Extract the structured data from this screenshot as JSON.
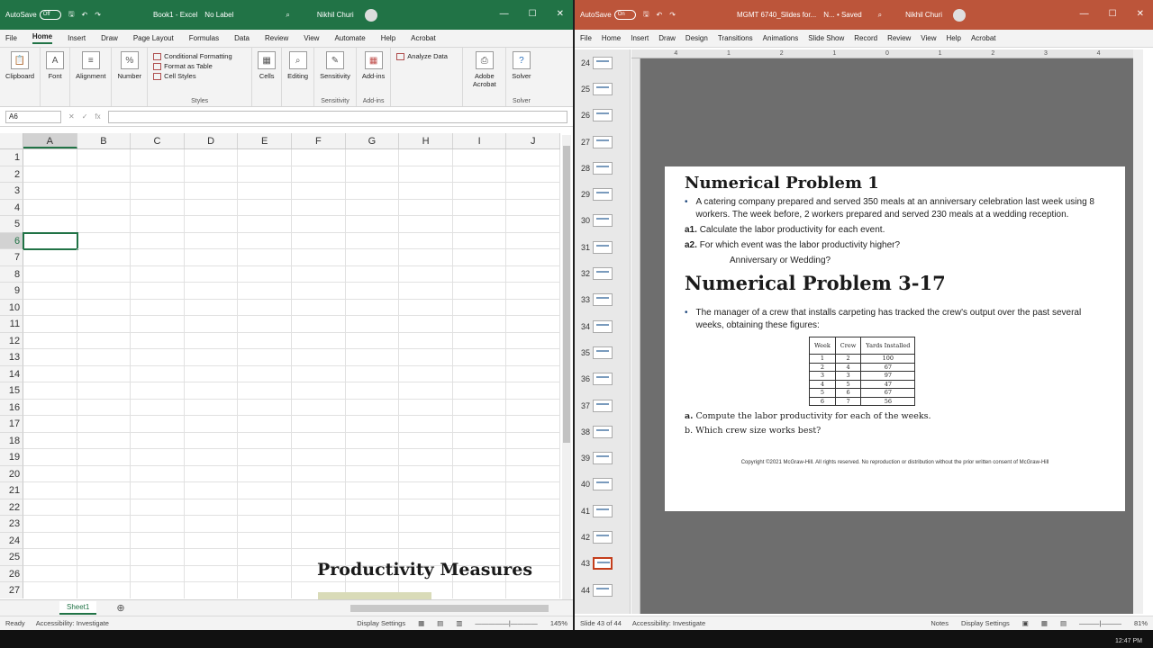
{
  "excel": {
    "autosave_label": "AutoSave",
    "autosave_state": "Off",
    "doc_title": "Book1 - Excel",
    "sensitivity": "No Label",
    "user": "Nikhil Churi",
    "menu": [
      "File",
      "Home",
      "Insert",
      "Draw",
      "Page Layout",
      "Formulas",
      "Data",
      "Review",
      "View",
      "Automate",
      "Help",
      "Acrobat"
    ],
    "ribbon": {
      "clipboard": "Clipboard",
      "font": "Font",
      "alignment": "Alignment",
      "number": "Number",
      "conditional_formatting": "Conditional Formatting",
      "format_as_table": "Format as Table",
      "cell_styles": "Cell Styles",
      "styles_group": "Styles",
      "cells": "Cells",
      "editing": "Editing",
      "sensitivity": "Sensitivity",
      "sensitivity_group": "Sensitivity",
      "addins": "Add-ins",
      "addins_group": "Add-ins",
      "analyze_data": "Analyze Data",
      "adobe_acrobat": "Adobe Acrobat",
      "solver": "Solver",
      "solver_group": "Solver"
    },
    "name_box": "A6",
    "fx": "fx",
    "columns": [
      "A",
      "B",
      "C",
      "D",
      "E",
      "F",
      "G",
      "H",
      "I",
      "J"
    ],
    "rows": [
      "1",
      "2",
      "3",
      "4",
      "5",
      "6",
      "7",
      "8",
      "9",
      "10",
      "11",
      "12",
      "13",
      "14",
      "15",
      "16",
      "17",
      "18",
      "19",
      "20",
      "21",
      "22",
      "23",
      "24",
      "25",
      "26",
      "27"
    ],
    "overlay_title": "Productivity Measures",
    "sheet_tab": "Sheet1",
    "status_ready": "Ready",
    "status_accessibility": "Accessibility: Investigate",
    "display_settings": "Display Settings",
    "zoom": "145%"
  },
  "ppt": {
    "autosave_label": "AutoSave",
    "autosave_state": "On",
    "doc_title": "MGMT 6740_Slides for...",
    "saved": "N... • Saved",
    "user": "Nikhil Churi",
    "menu": [
      "File",
      "Home",
      "Insert",
      "Draw",
      "Design",
      "Transitions",
      "Animations",
      "Slide Show",
      "Record",
      "Review",
      "View",
      "Help",
      "Acrobat"
    ],
    "thumbs": [
      "24",
      "25",
      "26",
      "27",
      "28",
      "29",
      "30",
      "31",
      "32",
      "33",
      "34",
      "35",
      "36",
      "37",
      "38",
      "39",
      "40",
      "41",
      "42",
      "43",
      "44"
    ],
    "selected_thumb": "43",
    "ruler": [
      "4",
      "1",
      "2",
      "1",
      "0",
      "1",
      "2",
      "3",
      "4"
    ],
    "slide": {
      "title1": "Numerical Problem 1",
      "bullet1": "A catering company prepared and served 350 meals at an anniversary celebration last week using 8 workers. The week before, 2 workers prepared and served 230 meals at a wedding reception.",
      "a1_label": "a1.",
      "a1_text": "Calculate the labor productivity for each event.",
      "a2_label": "a2.",
      "a2_text": "For which event was the labor productivity higher?",
      "a2_options": "Anniversary or Wedding?",
      "title2": "Numerical Problem 3-17",
      "bullet2": "The manager of a crew that installs carpeting has tracked the crew's output over the past several weeks, obtaining these figures:",
      "table_headers": [
        "Week",
        "Crew",
        "Yards Installed"
      ],
      "table_rows": [
        [
          "1",
          "2",
          "100"
        ],
        [
          "2",
          "4",
          "67"
        ],
        [
          "3",
          "3",
          "97"
        ],
        [
          "4",
          "5",
          "47"
        ],
        [
          "5",
          "6",
          "67"
        ],
        [
          "6",
          "7",
          "56"
        ]
      ],
      "qa_label": "a.",
      "qa_text": "Compute the labor productivity for each of the weeks.",
      "qb": "b. Which crew size works best?",
      "copyright": "Copyright ©2021 McGraw-Hill.  All rights reserved. No reproduction or distribution without the prior written consent of McGraw-Hill"
    },
    "status_slide": "Slide 43 of 44",
    "status_accessibility": "Accessibility: Investigate",
    "notes": "Notes",
    "display_settings": "Display Settings",
    "zoom": "81%"
  },
  "clock": "12:47 PM"
}
